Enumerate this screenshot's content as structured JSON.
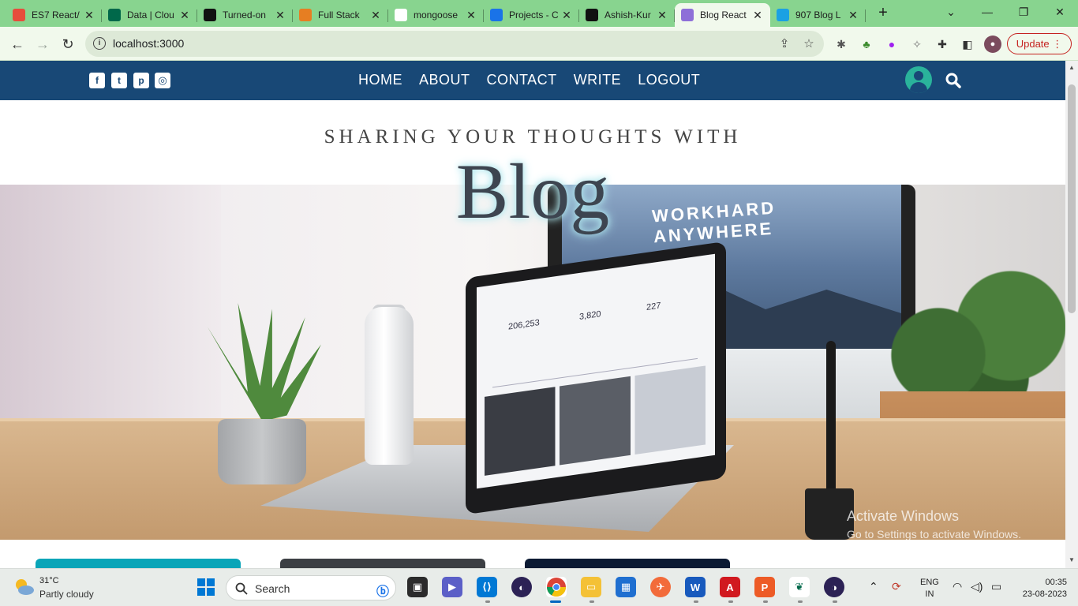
{
  "browser": {
    "tabs": [
      {
        "title": "ES7 React/",
        "fav_color": "#e74c3c",
        "icon": "windows-store-icon"
      },
      {
        "title": "Data | Clou",
        "fav_color": "#00684a",
        "icon": "mongodb-leaf-icon"
      },
      {
        "title": "Turned-on",
        "fav_color": "#111111",
        "icon": "company-logo-icon"
      },
      {
        "title": "Full Stack",
        "fav_color": "#e67e22",
        "icon": "cube-icon"
      },
      {
        "title": "mongoose",
        "fav_color": "#ffffff",
        "icon": "google-icon"
      },
      {
        "title": "Projects - C",
        "fav_color": "#1a73e8",
        "icon": "projects-icon"
      },
      {
        "title": "Ashish-Kur",
        "fav_color": "#111111",
        "icon": "github-icon"
      },
      {
        "title": "Blog React",
        "fav_color": "#8e6fd8",
        "icon": "react-icon",
        "active": true
      },
      {
        "title": "907 Blog L",
        "fav_color": "#1aa1e3",
        "icon": "search-engine-icon"
      }
    ],
    "new_tab": "+",
    "url": "localhost:3000",
    "update_label": "Update",
    "chrome_color": "#88d48f"
  },
  "site": {
    "nav_bg": "#184876",
    "social": [
      "facebook-icon",
      "twitter-icon",
      "pinterest-icon",
      "instagram-icon"
    ],
    "links": [
      "HOME",
      "ABOUT",
      "CONTACT",
      "WRITE",
      "LOGOUT"
    ],
    "header_small": "SHARING YOUR THOUGHTS WITH",
    "header_large": "Blog",
    "hero": {
      "screen_text": "WORKHARD\nANYWHERE",
      "stats": [
        "206,253",
        "3,820",
        "227"
      ]
    },
    "card_colors": [
      "#0aa5b8",
      "#3c3f44",
      "#0b1a33"
    ]
  },
  "watermark": {
    "line1": "Activate Windows",
    "line2": "Go to Settings to activate Windows."
  },
  "taskbar": {
    "weather_temp": "31°C",
    "weather_desc": "Partly cloudy",
    "search_label": "Search",
    "lang_line1": "ENG",
    "lang_line2": "IN",
    "time": "00:35",
    "date": "23-08-2023"
  }
}
